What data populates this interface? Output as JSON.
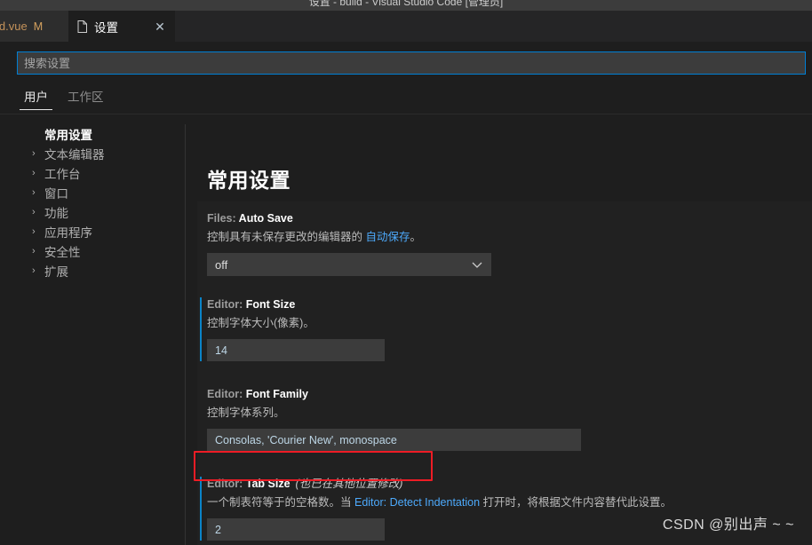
{
  "window": {
    "titlebar_text": "设置 - build - Visual Studio Code [管理员]"
  },
  "tabs": {
    "items": [
      {
        "label": "ld.vue",
        "badge": "M",
        "state": "inactive-modified"
      },
      {
        "label": "设置",
        "state": "active"
      }
    ],
    "close_icon": "✕",
    "file_icon": "file-icon"
  },
  "search": {
    "placeholder": "搜索设置",
    "value": ""
  },
  "scope_tabs": [
    {
      "label": "用户",
      "active": true
    },
    {
      "label": "工作区",
      "active": false
    }
  ],
  "toc": {
    "items": [
      {
        "label": "常用设置",
        "selected": true,
        "expandable": false
      },
      {
        "label": "文本编辑器",
        "selected": false,
        "expandable": true
      },
      {
        "label": "工作台",
        "selected": false,
        "expandable": true
      },
      {
        "label": "窗口",
        "selected": false,
        "expandable": true
      },
      {
        "label": "功能",
        "selected": false,
        "expandable": true
      },
      {
        "label": "应用程序",
        "selected": false,
        "expandable": true
      },
      {
        "label": "安全性",
        "selected": false,
        "expandable": true
      },
      {
        "label": "扩展",
        "selected": false,
        "expandable": true
      }
    ],
    "chevron_icon": "›"
  },
  "content": {
    "title": "常用设置",
    "settings": [
      {
        "prefix": "Files: ",
        "name": "Auto Save",
        "modified_note": "",
        "desc_before": "控制具有未保存更改的编辑器的 ",
        "desc_link": "自动保存",
        "desc_after": "。",
        "control": "select",
        "value": "off",
        "modified": false,
        "chevron_icon": "⌄"
      },
      {
        "prefix": "Editor: ",
        "name": "Font Size",
        "modified_note": "",
        "desc_before": "控制字体大小(像素)。",
        "desc_link": "",
        "desc_after": "",
        "control": "input",
        "value": "14",
        "modified": true
      },
      {
        "prefix": "Editor: ",
        "name": "Font Family",
        "modified_note": "",
        "desc_before": "控制字体系列。",
        "desc_link": "",
        "desc_after": "",
        "control": "input",
        "value": "Consolas, 'Courier New', monospace",
        "modified": false
      },
      {
        "prefix": "Editor: ",
        "name": "Tab Size",
        "modified_note": "(也已在其他位置修改)",
        "desc_before": "一个制表符等于的空格数。当 ",
        "desc_link": "Editor: Detect Indentation",
        "desc_after": " 打开时，将根据文件内容替代此设置。",
        "control": "input",
        "value": "2",
        "modified": true
      }
    ]
  },
  "annotation": {
    "color": "#ee1c25",
    "target": "Editor: Tab Size"
  },
  "watermark": {
    "text": "CSDN @别出声 ~ ~"
  },
  "colors": {
    "accent": "#007fd4",
    "modified_indicator": "#0a84c8",
    "link": "#4daafc",
    "annotation": "#ee1c25",
    "tab_modified": "#c4925a"
  }
}
